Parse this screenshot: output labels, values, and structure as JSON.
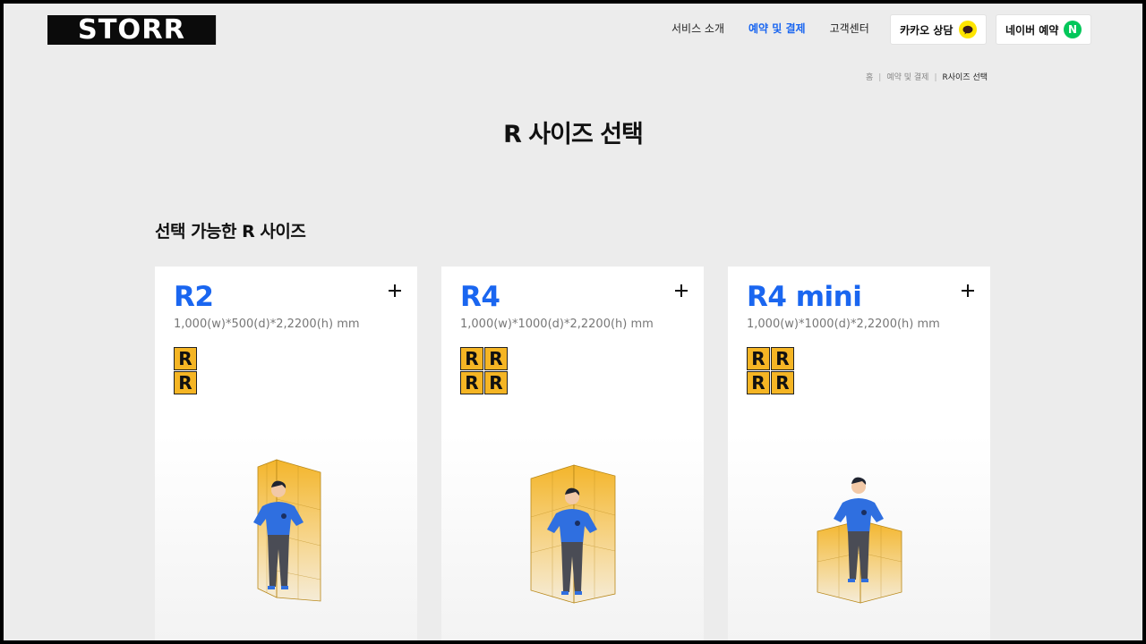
{
  "header": {
    "logo": "STORR",
    "nav": [
      "서비스 소개",
      "예약 및 결제",
      "고객센터"
    ],
    "active_nav": "예약 및 결제",
    "kakao_label": "카카오 상담",
    "naver_label": "네이버 예약",
    "naver_icon_letter": "N"
  },
  "breadcrumb": [
    "홈",
    "예약 및 결제",
    "R사이즈 선택"
  ],
  "page_title": "R 사이즈 선택",
  "section_title": "선택 가능한 R 사이즈",
  "cards": [
    {
      "name": "R2",
      "dims": "1,000(w)*500(d)*2,2200(h) mm",
      "grid_cols": 1,
      "grid_rows": 2,
      "box_letter": "R"
    },
    {
      "name": "R4",
      "dims": "1,000(w)*1000(d)*2,2200(h) mm",
      "grid_cols": 2,
      "grid_rows": 2,
      "box_letter": "R"
    },
    {
      "name": "R4 mini",
      "dims": "1,000(w)*1000(d)*2,2200(h) mm",
      "grid_cols": 2,
      "grid_rows": 2,
      "box_letter": "R"
    }
  ],
  "colors": {
    "accent": "#1a66f0",
    "storage_yellow": "#f5b524",
    "kakao_yellow": "#fee500",
    "naver_green": "#03c75a",
    "shirt_blue": "#2f6fe0"
  },
  "icons": [
    "plus-icon",
    "kakao-chat-icon",
    "naver-icon",
    "storage-unit-icon",
    "person-illustration"
  ]
}
